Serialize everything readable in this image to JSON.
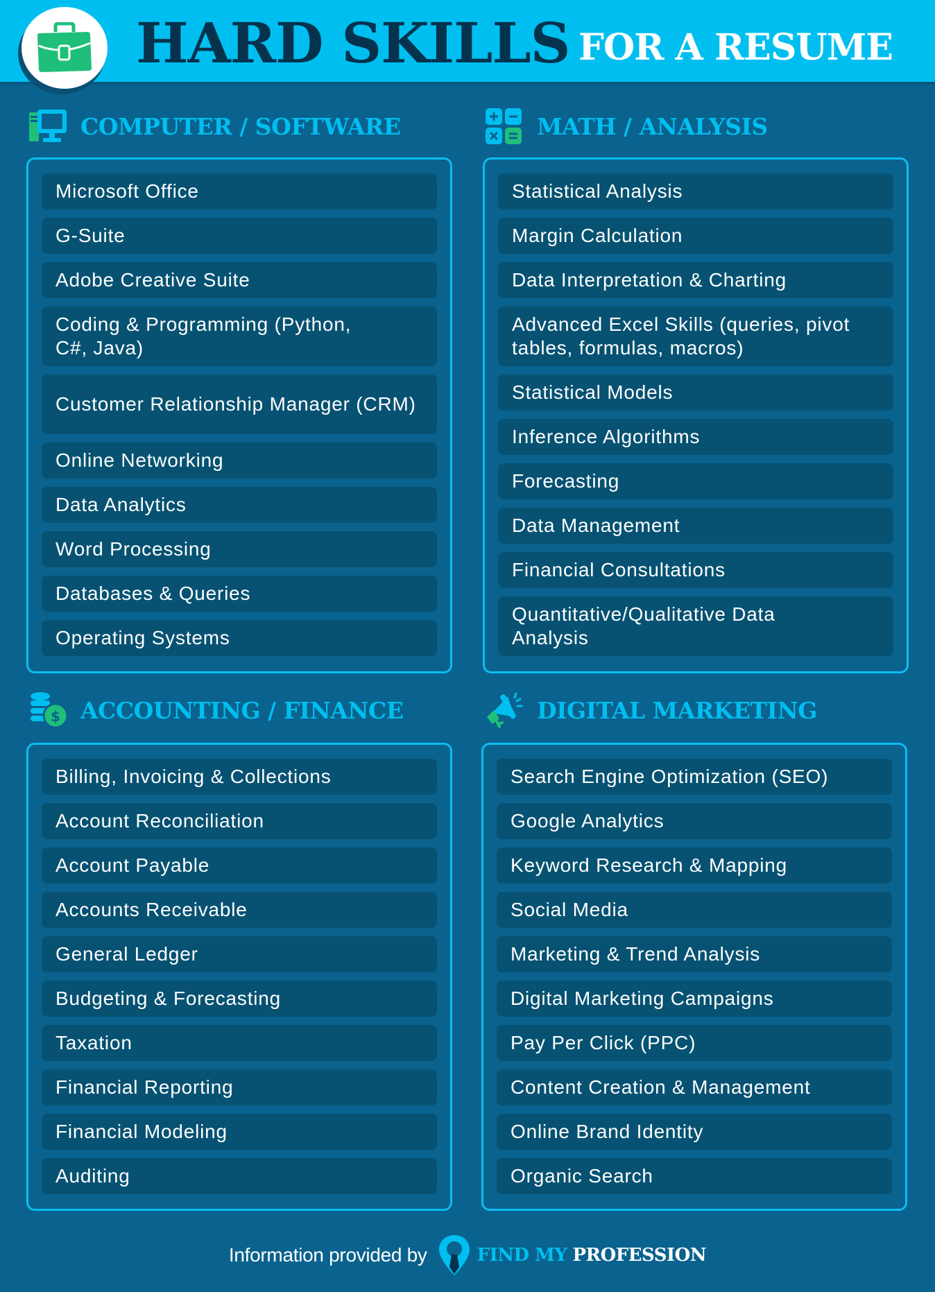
{
  "header": {
    "title_main": "HARD SKILLS",
    "title_sub": "FOR A RESUME",
    "logo_icon": "briefcase-icon"
  },
  "colors": {
    "header_bg": "#00bff0",
    "page_bg": "#0a628e",
    "title_dark": "#05324d",
    "accent_cyan": "#00bff0",
    "accent_green": "#1fbf7a",
    "item_bg": "#075272",
    "item_text": "#ffffff"
  },
  "sections": [
    {
      "title": "COMPUTER / SOFTWARE",
      "icon": "computer-icon",
      "items": [
        "Microsoft Office",
        "G-Suite",
        "Adobe Creative Suite",
        "Coding & Programming (Python, C#, Java)",
        "Customer Relationship Manager (CRM)",
        "Online Networking",
        "Data Analytics",
        "Word Processing",
        "Databases & Queries",
        "Operating Systems"
      ]
    },
    {
      "title": "MATH / ANALYSIS",
      "icon": "calculator-icon",
      "items": [
        "Statistical Analysis",
        "Margin Calculation",
        "Data Interpretation & Charting",
        "Advanced Excel Skills (queries, pivot tables, formulas, macros)",
        "Statistical Models",
        "Inference Algorithms",
        "Forecasting",
        "Data Management",
        "Financial Consultations",
        "Quantitative/Qualitative Data Analysis"
      ]
    },
    {
      "title": "ACCOUNTING / FINANCE",
      "icon": "coins-icon",
      "items": [
        "Billing, Invoicing & Collections",
        "Account Reconciliation",
        "Account Payable",
        "Accounts Receivable",
        "General Ledger",
        "Budgeting & Forecasting",
        "Taxation",
        "Financial Reporting",
        "Financial Modeling",
        "Auditing"
      ]
    },
    {
      "title": "DIGITAL MARKETING",
      "icon": "megaphone-icon",
      "items": [
        "Search Engine Optimization (SEO)",
        "Google Analytics",
        "Keyword Research & Mapping",
        "Social Media",
        "Marketing & Trend Analysis",
        "Digital Marketing Campaigns",
        "Pay Per Click (PPC)",
        "Content Creation & Management",
        "Online Brand Identity",
        "Organic Search"
      ]
    }
  ],
  "footer": {
    "text": "Information provided by",
    "brand_part1": "FIND MY",
    "brand_part2": "PROFESSION",
    "brand_icon": "location-pin-tie-icon"
  }
}
